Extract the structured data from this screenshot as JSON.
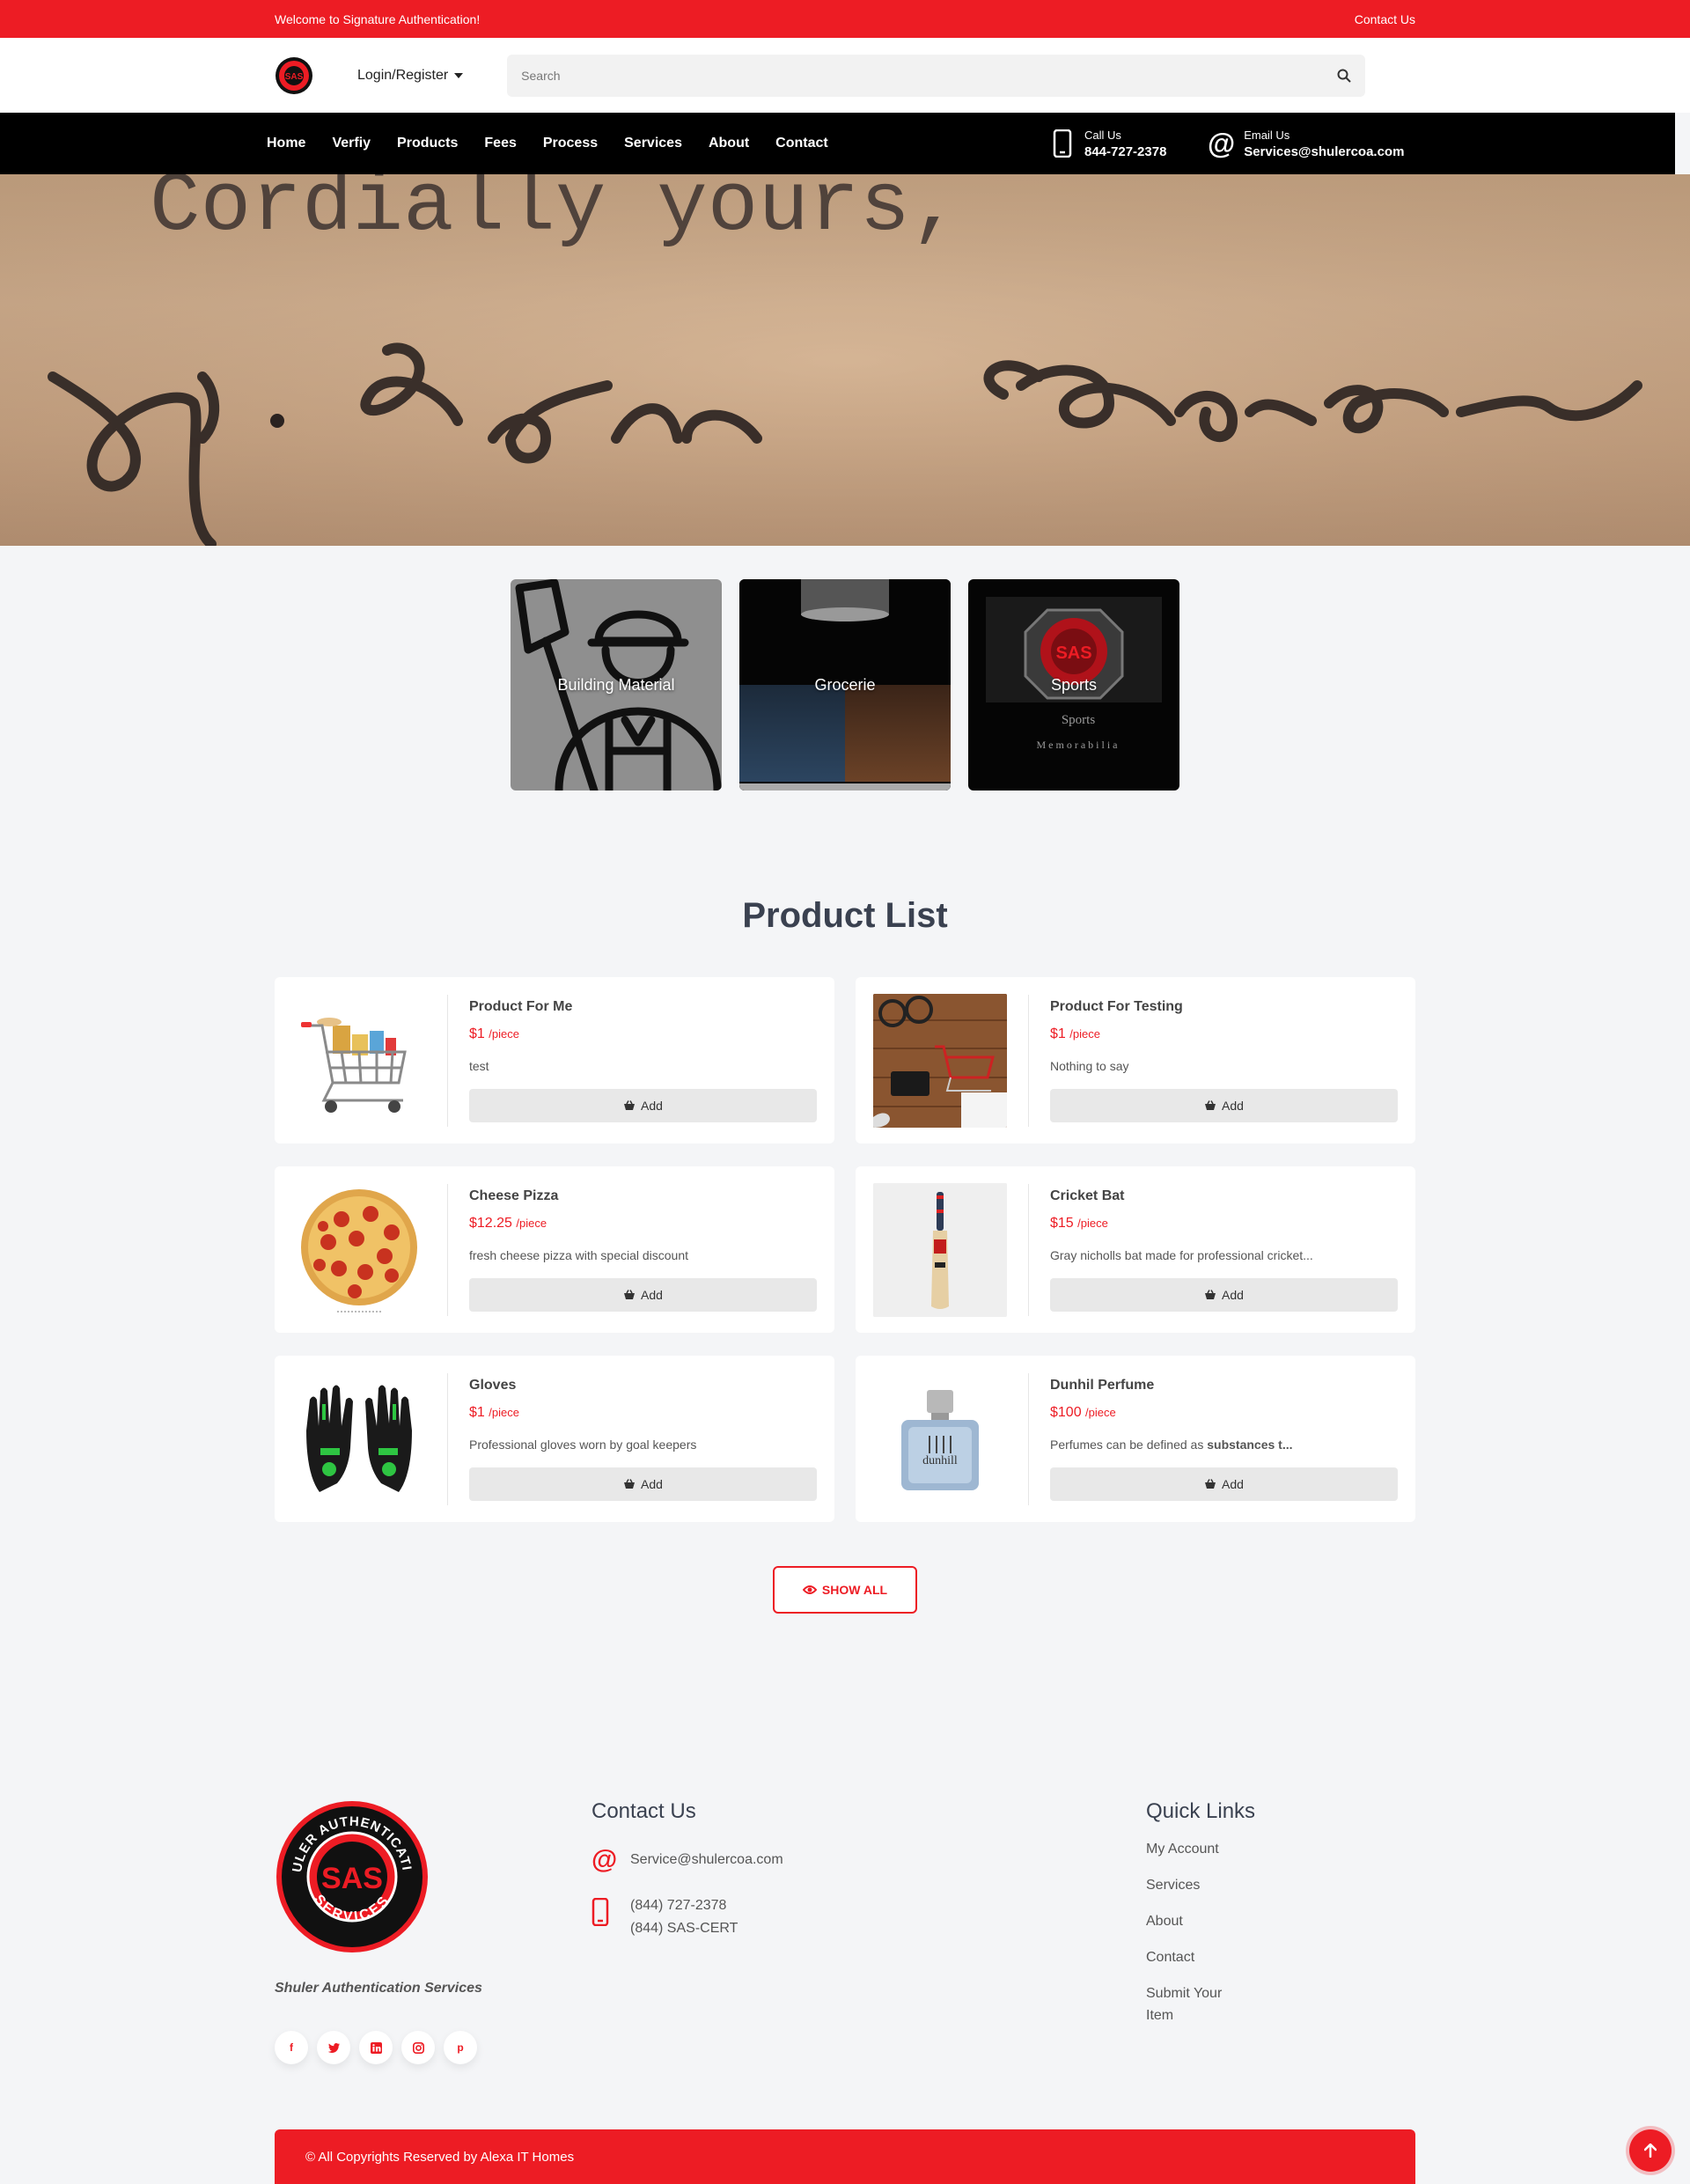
{
  "topbar": {
    "welcome": "Welcome to Signature Authentication!",
    "contact_link": "Contact Us"
  },
  "header": {
    "login_label": "Login/Register",
    "search_placeholder": "Search"
  },
  "nav": {
    "items": [
      "Home",
      "Verfiy",
      "Products",
      "Fees",
      "Process",
      "Services",
      "About",
      "Contact"
    ],
    "call_label": "Call Us",
    "call_value": "844-727-2378",
    "email_label": "Email Us",
    "email_value": "Services@shulercoa.com"
  },
  "hero": {
    "handwritten_text": "Cordially yours,"
  },
  "categories": [
    {
      "label": "Building Material"
    },
    {
      "label": "Grocerie"
    },
    {
      "label": "Sports",
      "image_text_1": "Sports",
      "image_text_2": "Memorabilia"
    }
  ],
  "products": {
    "title": "Product List",
    "items": [
      {
        "name": "Product For Me",
        "price": "$1",
        "unit": "/piece",
        "desc": "test",
        "icon": "shopping-cart-groceries"
      },
      {
        "name": "Product For Testing",
        "price": "$1",
        "unit": "/piece",
        "desc": "Nothing to say",
        "icon": "desk-cart-photo"
      },
      {
        "name": "Cheese Pizza",
        "price": "$12.25",
        "unit": "/piece",
        "desc": "fresh cheese pizza with special discount",
        "icon": "pizza"
      },
      {
        "name": "Cricket Bat",
        "price": "$15",
        "unit": "/piece",
        "desc": "Gray nicholls bat made for professional cricket...",
        "icon": "cricket-bat"
      },
      {
        "name": "Gloves",
        "price": "$1",
        "unit": "/piece",
        "desc": "Professional gloves worn by goal keepers",
        "icon": "gloves"
      },
      {
        "name": "Dunhil Perfume",
        "price": "$100",
        "unit": "/piece",
        "desc_plain": "Perfumes can be defined as ",
        "desc_bold": "substances t...",
        "icon": "perfume"
      }
    ],
    "add_label": "Add",
    "show_all_label": "SHOW ALL"
  },
  "footer": {
    "logo_top_text": "SHULER AUTHENTICATION",
    "logo_bottom_text": "SERVICES",
    "logo_monogram": "SAS",
    "tagline": "Shuler Authentication Services",
    "contact_title": "Contact Us",
    "email": "Service@shulercoa.com",
    "phone_1": "(844) 727-2378",
    "phone_2": "(844) SAS-CERT",
    "links_title": "Quick Links",
    "links": [
      "My Account",
      "Services",
      "About",
      "Contact",
      "Submit Your Item"
    ],
    "socials": [
      "f",
      "t",
      "in",
      "ig",
      "p"
    ],
    "copyright": "© All Copyrights Reserved by Alexa IT Homes"
  },
  "colors": {
    "brand_red": "#ed1c24",
    "nav_black": "#000000",
    "page_bg": "#f4f5f7"
  }
}
